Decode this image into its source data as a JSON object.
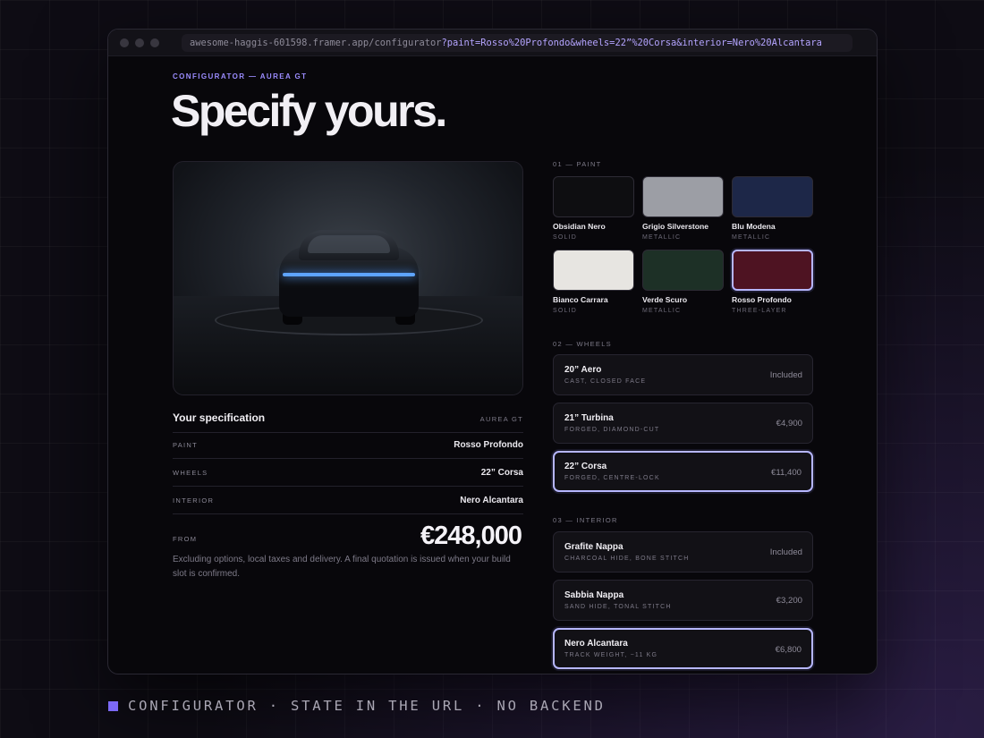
{
  "browser": {
    "url_host": "awesome-haggis-601598.framer.app/configurator",
    "url_query": "?paint=Rosso%20Profondo&wheels=22”%20Corsa&interior=Nero%20Alcantara"
  },
  "header": {
    "eyebrow": "CONFIGURATOR — AUREA GT",
    "title": "Specify yours."
  },
  "specification": {
    "title": "Your specification",
    "model": "AUREA GT",
    "rows": [
      {
        "label": "PAINT",
        "value": "Rosso Profondo"
      },
      {
        "label": "WHEELS",
        "value": "22” Corsa"
      },
      {
        "label": "INTERIOR",
        "value": "Nero Alcantara"
      }
    ],
    "from_label": "FROM",
    "price": "€248,000",
    "disclaimer": "Excluding options, local taxes and delivery. A final quotation is issued when your build slot is confirmed."
  },
  "paint": {
    "label": "01 — PAINT",
    "swatches": [
      {
        "name": "Obsidian Nero",
        "finish": "SOLID",
        "color": "#0e0e11"
      },
      {
        "name": "Grigio Silverstone",
        "finish": "METALLIC",
        "color": "#9c9ea5"
      },
      {
        "name": "Blu Modena",
        "finish": "METALLIC",
        "color": "#1d2748"
      },
      {
        "name": "Bianco Carrara",
        "finish": "SOLID",
        "color": "#e7e5e1"
      },
      {
        "name": "Verde Scuro",
        "finish": "METALLIC",
        "color": "#1d3026"
      },
      {
        "name": "Rosso Profondo",
        "finish": "THREE-LAYER",
        "color": "#4e1322",
        "selected": true
      }
    ]
  },
  "wheels": {
    "label": "02 — WHEELS",
    "options": [
      {
        "name": "20” Aero",
        "desc": "CAST, CLOSED FACE",
        "price": "Included"
      },
      {
        "name": "21” Turbina",
        "desc": "FORGED, DIAMOND-CUT",
        "price": "€4,900"
      },
      {
        "name": "22” Corsa",
        "desc": "FORGED, CENTRE-LOCK",
        "price": "€11,400",
        "selected": true
      }
    ]
  },
  "interior": {
    "label": "03 — INTERIOR",
    "options": [
      {
        "name": "Grafite Nappa",
        "desc": "CHARCOAL HIDE, BONE STITCH",
        "price": "Included"
      },
      {
        "name": "Sabbia Nappa",
        "desc": "SAND HIDE, TONAL STITCH",
        "price": "€3,200"
      },
      {
        "name": "Nero Alcantara",
        "desc": "TRACK WEIGHT, −11 KG",
        "price": "€6,800",
        "selected": true
      }
    ]
  },
  "caption": "CONFIGURATOR · STATE IN THE URL · NO BACKEND",
  "accent_color": "#b6b6ff"
}
